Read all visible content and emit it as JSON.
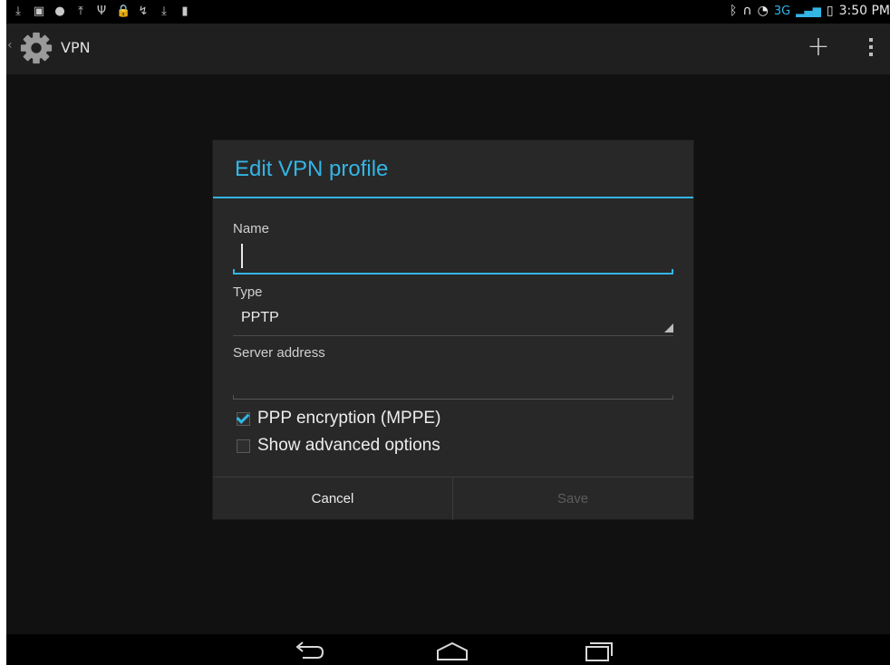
{
  "status_bar": {
    "notification_icons": [
      "download-icon",
      "image-icon",
      "alert-icon",
      "upload-icon",
      "usb-icon",
      "lock-icon",
      "missed-call-icon",
      "download-icon",
      "sd-card-icon"
    ],
    "right_icons": [
      "bluetooth-icon",
      "headset-icon",
      "wifi-icon",
      "signal-icon",
      "battery-icon"
    ],
    "network_type": "3G",
    "time": "3:50 PM",
    "accent_color": "#33b5e5"
  },
  "action_bar": {
    "title": "VPN",
    "icon": "settings-gear-icon",
    "actions": [
      "add-icon",
      "overflow-menu-icon"
    ]
  },
  "dialog": {
    "title": "Edit VPN profile",
    "name": {
      "label": "Name",
      "value": ""
    },
    "type": {
      "label": "Type",
      "value": "PPTP"
    },
    "server": {
      "label": "Server address",
      "value": ""
    },
    "options": [
      {
        "label": "PPP encryption (MPPE)",
        "checked": true
      },
      {
        "label": "Show advanced options",
        "checked": false
      }
    ],
    "buttons": {
      "cancel": "Cancel",
      "save": "Save"
    }
  },
  "nav_bar": {
    "buttons": [
      "back-icon",
      "home-icon",
      "recent-apps-icon"
    ]
  }
}
